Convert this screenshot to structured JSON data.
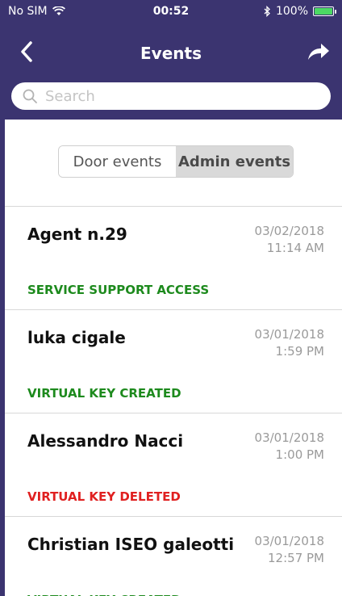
{
  "status_bar": {
    "carrier": "No SIM",
    "time": "00:52",
    "battery_pct": "100%"
  },
  "nav": {
    "title": "Events",
    "back_icon": "chevron-left-icon",
    "share_icon": "share-arrow-icon"
  },
  "search": {
    "placeholder": "Search"
  },
  "segment": {
    "door_label": "Door events",
    "admin_label": "Admin events",
    "selected": "Admin events"
  },
  "events": [
    {
      "name": "Agent n.29",
      "date": "03/02/2018",
      "time": "11:14 AM",
      "type": "SERVICE SUPPORT ACCESS",
      "type_color": "#1d8a1d"
    },
    {
      "name": "luka cigale",
      "date": "03/01/2018",
      "time": "1:59 PM",
      "type": "VIRTUAL KEY CREATED",
      "type_color": "#1d8a1d"
    },
    {
      "name": "Alessandro Nacci",
      "date": "03/01/2018",
      "time": "1:00 PM",
      "type": "VIRTUAL KEY DELETED",
      "type_color": "#e02020"
    },
    {
      "name": "Christian ISEO galeotti",
      "date": "03/01/2018",
      "time": "12:57 PM",
      "type": "VIRTUAL KEY CREATED",
      "type_color": "#1d8a1d"
    }
  ],
  "colors": {
    "header": "#3b3470",
    "accent_green": "#1d8a1d",
    "accent_red": "#e02020"
  }
}
